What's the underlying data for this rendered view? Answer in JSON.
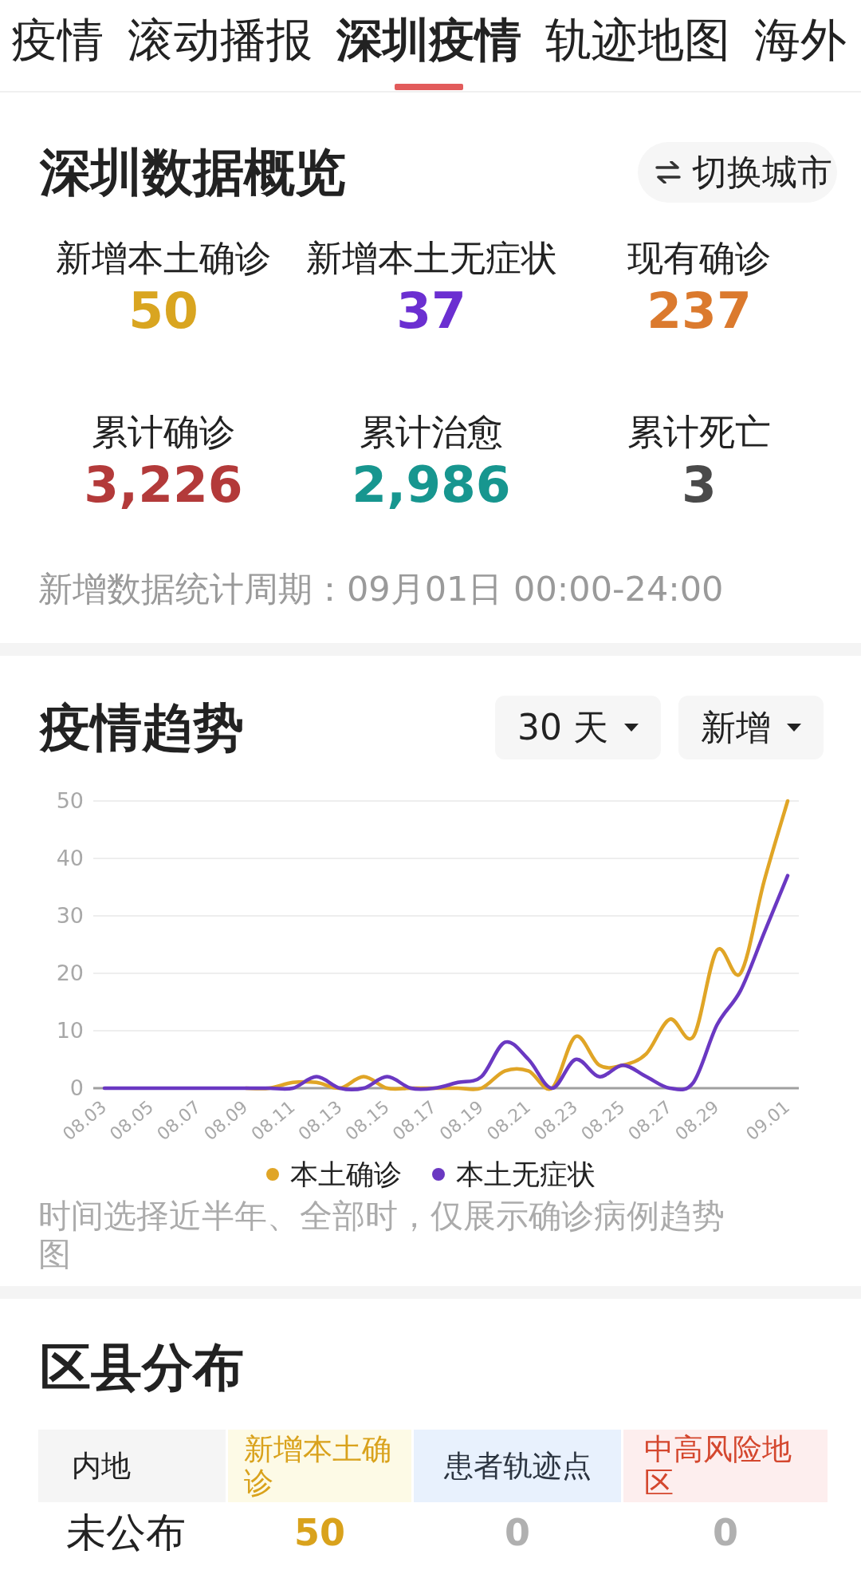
{
  "tabs": [
    {
      "label": "疫情",
      "selected": false
    },
    {
      "label": "滚动播报",
      "selected": false
    },
    {
      "label": "深圳疫情",
      "selected": true
    },
    {
      "label": "轨迹地图",
      "selected": false
    },
    {
      "label": "海外",
      "selected": false
    }
  ],
  "overview": {
    "title": "深圳数据概览",
    "switch_button": "切换城市",
    "stats": [
      {
        "label": "新增本土确诊",
        "value": "50",
        "color": "#d9a520"
      },
      {
        "label": "新增本土无症状",
        "value": "37",
        "color": "#6b2fd1"
      },
      {
        "label": "现有确诊",
        "value": "237",
        "color": "#db7a2e"
      },
      {
        "label": "累计确诊",
        "value": "3,226",
        "color": "#b33a3a"
      },
      {
        "label": "累计治愈",
        "value": "2,986",
        "color": "#17968f"
      },
      {
        "label": "累计死亡",
        "value": "3",
        "color": "#4a4a4a"
      }
    ],
    "period": "新增数据统计周期：09月01日 00:00-24:00"
  },
  "trend": {
    "title": "疫情趋势",
    "filters": [
      "30 天",
      "新增"
    ],
    "chart_data": {
      "type": "line",
      "categories": [
        "08.03",
        null,
        "08.05",
        null,
        "08.07",
        null,
        "08.09",
        null,
        "08.11",
        null,
        "08.13",
        null,
        "08.15",
        null,
        "08.17",
        null,
        "08.19",
        null,
        "08.21",
        null,
        "08.23",
        null,
        "08.25",
        null,
        "08.27",
        null,
        "08.29",
        null,
        null,
        "09.01"
      ],
      "series": [
        {
          "name": "本土确诊",
          "color": "#e0a526",
          "values": [
            null,
            null,
            null,
            null,
            null,
            null,
            0,
            0,
            1,
            1,
            0,
            2,
            0,
            0,
            0,
            0,
            0,
            3,
            3,
            0,
            9,
            4,
            4,
            6,
            12,
            9,
            24,
            20,
            36,
            50
          ]
        },
        {
          "name": "本土无症状",
          "color": "#6a38c2",
          "values": [
            0,
            0,
            0,
            0,
            0,
            0,
            0,
            0,
            0,
            2,
            0,
            0,
            2,
            0,
            0,
            1,
            2,
            8,
            5,
            0,
            5,
            2,
            4,
            2,
            0,
            1,
            11,
            17,
            27,
            37
          ]
        }
      ],
      "ylim": [
        0,
        50
      ],
      "yticks": [
        0,
        10,
        20,
        30,
        40,
        50
      ],
      "grid": true
    },
    "note": "时间选择近半年、全部时，仅展示确诊病例趋势图"
  },
  "districts": {
    "title": "区县分布",
    "columns": [
      {
        "label": "内地",
        "kind": "region"
      },
      {
        "label": "新增本土确诊",
        "kind": "confirmed"
      },
      {
        "label": "患者轨迹点",
        "kind": "tracks"
      },
      {
        "label": "中高风险地区",
        "kind": "risk"
      }
    ],
    "rows": [
      {
        "cells": [
          "未公布",
          "50",
          "0",
          "0"
        ]
      }
    ]
  }
}
